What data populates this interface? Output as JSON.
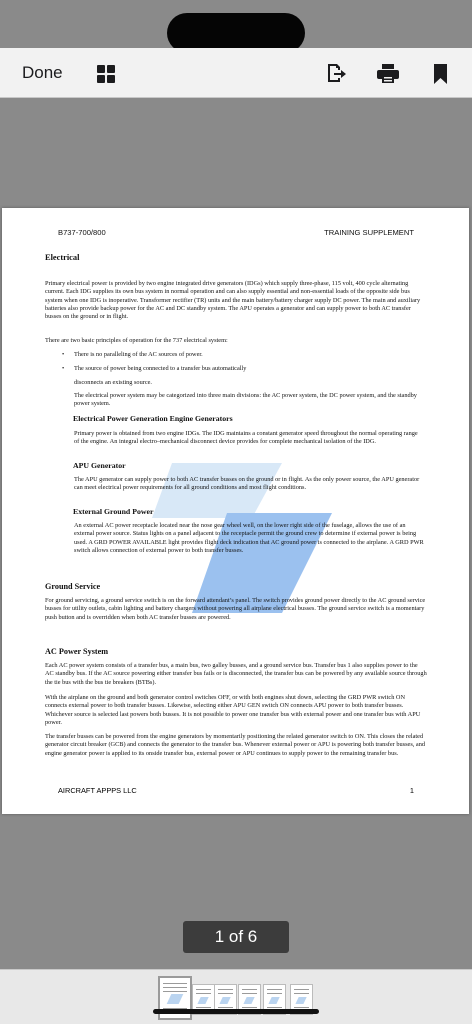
{
  "toolbar": {
    "done_label": "Done",
    "icons": [
      "grid-icon",
      "share-icon",
      "print-icon",
      "bookmark-icon"
    ]
  },
  "page": {
    "header_left": "B737-700/800",
    "header_right": "TRAINING SUPPLEMENT",
    "title": "Electrical",
    "intro": "Primary electrical power is provided by two engine integrated drive generators (IDGs) which supply three-phase, 115 volt, 400 cycle alternating current. Each IDG supplies its own bus system in normal operation and can also supply essential and non-essential loads of the opposite side bus system when one IDG is inoperative. Transformer rectifier (TR) units and the main battery/battery charger supply DC power. The main and auxiliary batteries also provide backup power for the AC and DC standby system. The APU operates a generator and can supply power to both AC transfer busses on the ground or in flight.",
    "principles_intro": "There are two basic principles of operation for the 737 electrical system:",
    "bullet_1": "There is no paralleling of the AC sources of power.",
    "bullet_2": "The source of power being connected to a transfer bus automatically",
    "bullet_2_cont": "disconnects an existing source.",
    "divisions": "The electrical power system may be categorized into three main divisions: the AC power system, the DC power system, and the standby power system.",
    "sub_1": "Electrical Power Generation Engine Generators",
    "sub_1_text": "Primary power is obtained from two engine IDGs. The IDG maintains a constant generator speed throughout the normal operating range of the engine. An integral electro–mechanical disconnect device provides for complete mechanical isolation of the IDG.",
    "sub_2": "APU Generator",
    "sub_2_text": "The APU generator can supply power to both AC transfer busses on the ground or in flight. As the only power source, the APU generator can meet electrical power requirements for all ground conditions and most flight conditions.",
    "sub_3": "External Ground Power",
    "sub_3_text": "An external AC power receptacle located near the nose gear wheel well, on the lower right side of the fuselage, allows the use of an external power source. Status lights on a panel adjacent to the receptacle permit the ground crew to determine if external power is being used. A GRD POWER AVAILABLE light provides flight deck indication that AC ground power is connected to the airplane. A GRD PWR switch allows connection of external power to both transfer busses.",
    "sec_ground": "Ground Service",
    "ground_text": "For ground servicing, a ground service switch is on the forward attendant’s panel. The switch provides ground power directly to the AC ground service busses for utility outlets, cabin lighting and battery chargers without powering all airplane electrical busses. The ground service switch is a momentary push button and is overridden when both AC transfer busses are powered.",
    "sec_ac": "AC Power System",
    "ac_text_1": "Each AC power system consists of a transfer bus, a main bus, two galley busses, and a ground service bus. Transfer bus 1 also supplies power to the AC standby bus. If the AC source powering either transfer bus fails or is disconnected, the transfer bus can be powered by any available source through the tie bus with the bus tie breakers (BTBs).",
    "ac_text_2": "With the airplane on the ground and both generator control switches OFF, or with both engines shut down, selecting the GRD PWR switch ON connects external power to both transfer busses. Likewise, selecting either APU GEN switch ON connects APU power to both transfer busses. Whichever source is selected last powers both busses. It is not possible to power one transfer bus with external power and one transfer bus with APU power.",
    "ac_text_3": "The transfer busses can be powered from the engine generators by momentarily positioning the related generator switch to ON. This closes the related generator circuit breaker (GCB) and connects the generator to the transfer bus. Whenever external power or APU is powering both transfer busses, and engine generator power is applied to its onside transfer bus, external power or APU continues to supply power to the remaining transfer bus.",
    "footer_left": "AIRCRAFT APPPS LLC",
    "footer_right": "1"
  },
  "page_indicator": "1 of 6",
  "thumbnails": {
    "count": 6,
    "selected_index": 0
  },
  "colors": {
    "watermark": "#4a90e2",
    "toolbar_bg": "#f2f2f2",
    "canvas_bg": "#8a8a8a"
  }
}
